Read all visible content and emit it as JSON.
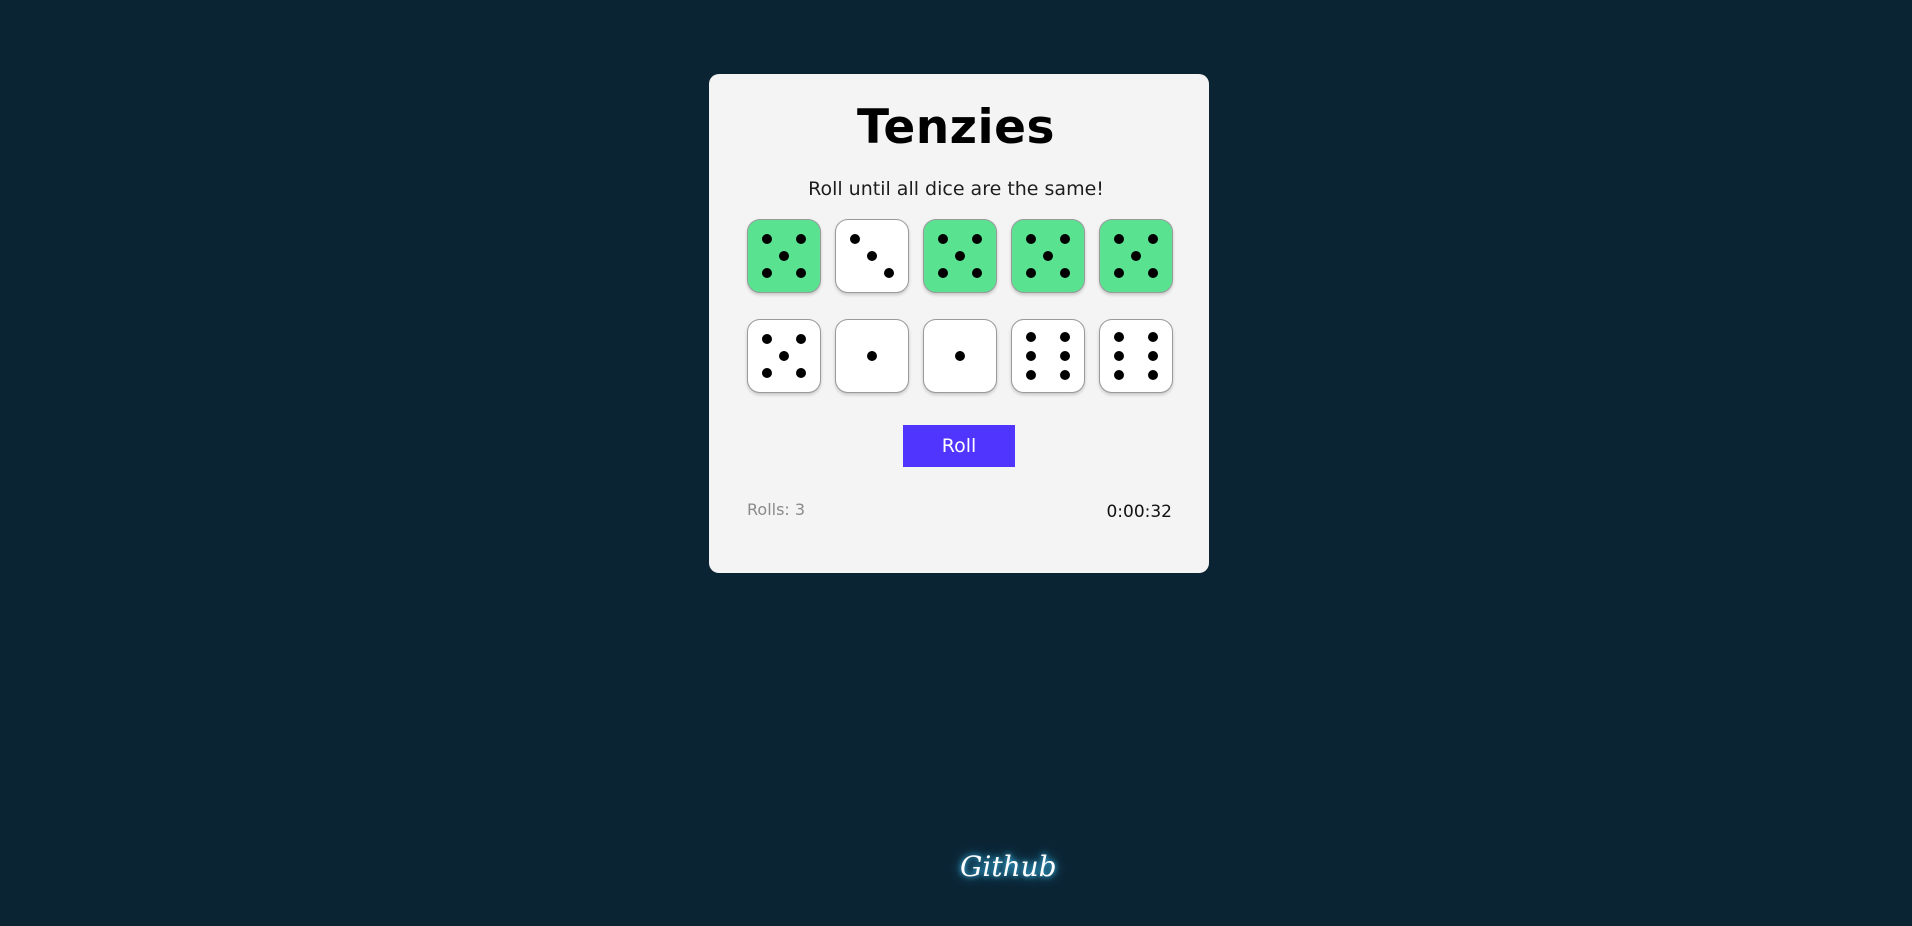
{
  "game": {
    "title": "Tenzies",
    "instructions": "Roll until all dice are the same!",
    "roll_button_label": "Roll",
    "rolls_text": "Rolls: 3",
    "timer_text": "0:00:32"
  },
  "dice": [
    {
      "value": 5,
      "held": true
    },
    {
      "value": 3,
      "held": false
    },
    {
      "value": 5,
      "held": true
    },
    {
      "value": 5,
      "held": true
    },
    {
      "value": 5,
      "held": true
    },
    {
      "value": 5,
      "held": false
    },
    {
      "value": 1,
      "held": false
    },
    {
      "value": 1,
      "held": false
    },
    {
      "value": 6,
      "held": false
    },
    {
      "value": 6,
      "held": false
    }
  ],
  "footer": {
    "github_label": "Github"
  },
  "colors": {
    "background": "#0b2434",
    "card": "#f4f4f4",
    "held_die": "#59e391",
    "free_die": "#ffffff",
    "roll_button": "#5035ff"
  }
}
